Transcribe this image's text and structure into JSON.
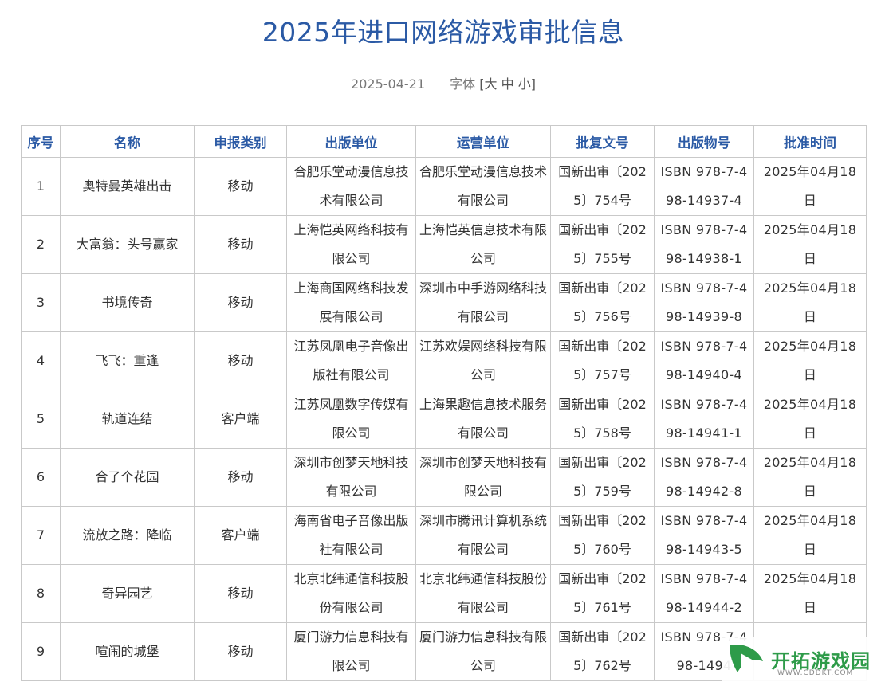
{
  "page": {
    "title": "2025年进口网络游戏审批信息",
    "date": "2025-04-21",
    "font_label": "字体",
    "font_open": "[",
    "font_large": "大",
    "font_medium": "中",
    "font_small": "小",
    "font_close": "]"
  },
  "table": {
    "headers": [
      "序号",
      "名称",
      "申报类别",
      "出版单位",
      "运营单位",
      "批复文号",
      "出版物号",
      "批准时间"
    ],
    "rows": [
      [
        "1",
        "奥特曼英雄出击",
        "移动",
        "合肥乐堂动漫信息技术有限公司",
        "合肥乐堂动漫信息技术有限公司",
        "国新出审〔2025〕754号",
        "ISBN 978-7-498-14937-4",
        "2025年04月18日"
      ],
      [
        "2",
        "大富翁：头号赢家",
        "移动",
        "上海恺英网络科技有限公司",
        "上海恺英信息技术有限公司",
        "国新出审〔2025〕755号",
        "ISBN 978-7-498-14938-1",
        "2025年04月18日"
      ],
      [
        "3",
        "书境传奇",
        "移动",
        "上海商国网络科技发展有限公司",
        "深圳市中手游网络科技有限公司",
        "国新出审〔2025〕756号",
        "ISBN 978-7-498-14939-8",
        "2025年04月18日"
      ],
      [
        "4",
        "飞飞：重逢",
        "移动",
        "江苏凤凰电子音像出版社有限公司",
        "江苏欢娱网络科技有限公司",
        "国新出审〔2025〕757号",
        "ISBN 978-7-498-14940-4",
        "2025年04月18日"
      ],
      [
        "5",
        "轨道连结",
        "客户端",
        "江苏凤凰数字传媒有限公司",
        "上海果趣信息技术服务有限公司",
        "国新出审〔2025〕758号",
        "ISBN 978-7-498-14941-1",
        "2025年04月18日"
      ],
      [
        "6",
        "合了个花园",
        "移动",
        "深圳市创梦天地科技有限公司",
        "深圳市创梦天地科技有限公司",
        "国新出审〔2025〕759号",
        "ISBN 978-7-498-14942-8",
        "2025年04月18日"
      ],
      [
        "7",
        "流放之路：降临",
        "客户端",
        "海南省电子音像出版社有限公司",
        "深圳市腾讯计算机系统有限公司",
        "国新出审〔2025〕760号",
        "ISBN 978-7-498-14943-5",
        "2025年04月18日"
      ],
      [
        "8",
        "奇异园艺",
        "移动",
        "北京北纬通信科技股份有限公司",
        "北京北纬通信科技股份有限公司",
        "国新出审〔2025〕761号",
        "ISBN 978-7-498-14944-2",
        "2025年04月18日"
      ],
      [
        "9",
        "喧闹的城堡",
        "移动",
        "厦门游力信息科技有限公司",
        "厦门游力信息科技有限公司",
        "国新出审〔2025〕762号",
        "ISBN 978-7-498-1494",
        ""
      ]
    ]
  },
  "watermark": {
    "name": "开拓游戏园",
    "url": "WWW.CDDKT.COM",
    "icon": "leaf-play-logo-icon"
  },
  "colors": {
    "accent": "#2b5aa5",
    "border": "#c9c9c9",
    "watermark_green": "#2e9b49"
  }
}
